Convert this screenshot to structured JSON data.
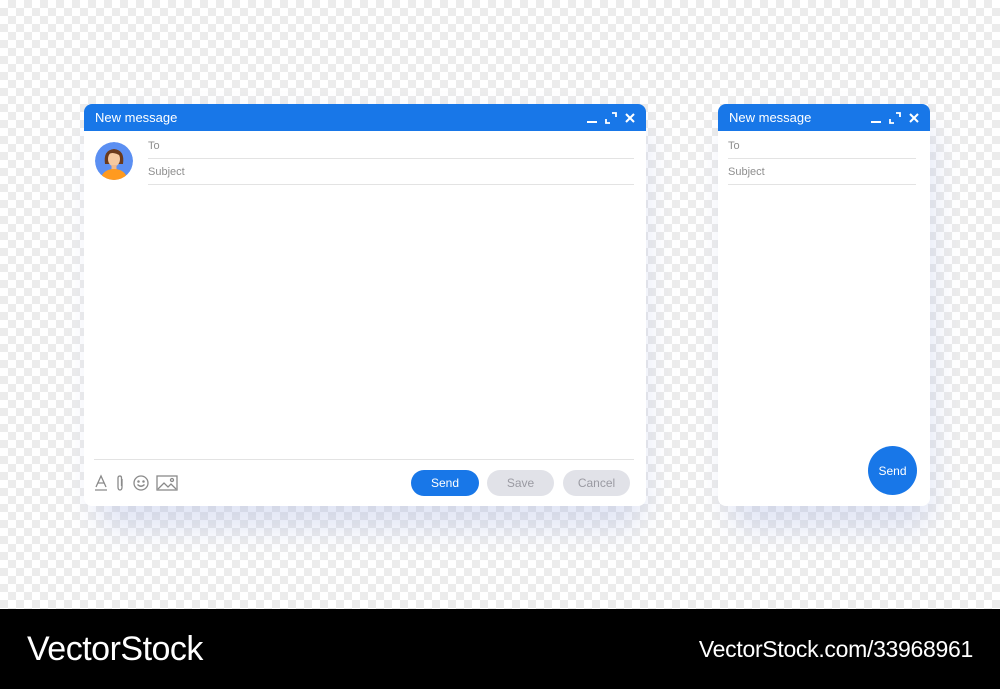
{
  "compose_large": {
    "title": "New message",
    "to_placeholder": "To",
    "subject_placeholder": "Subject",
    "toolbar_icons": [
      "text-format-icon",
      "attachment-icon",
      "emoji-icon",
      "image-icon"
    ],
    "send_label": "Send",
    "save_label": "Save",
    "cancel_label": "Cancel"
  },
  "compose_small": {
    "title": "New message",
    "to_placeholder": "To",
    "subject_placeholder": "Subject",
    "send_label": "Send"
  },
  "watermark": {
    "brand": "VectorStock",
    "stock_id": "VectorStock.com/33968961"
  },
  "colors": {
    "accent": "#1877e8",
    "disabled_button": "#e1e2e8",
    "footer": "#000000"
  }
}
